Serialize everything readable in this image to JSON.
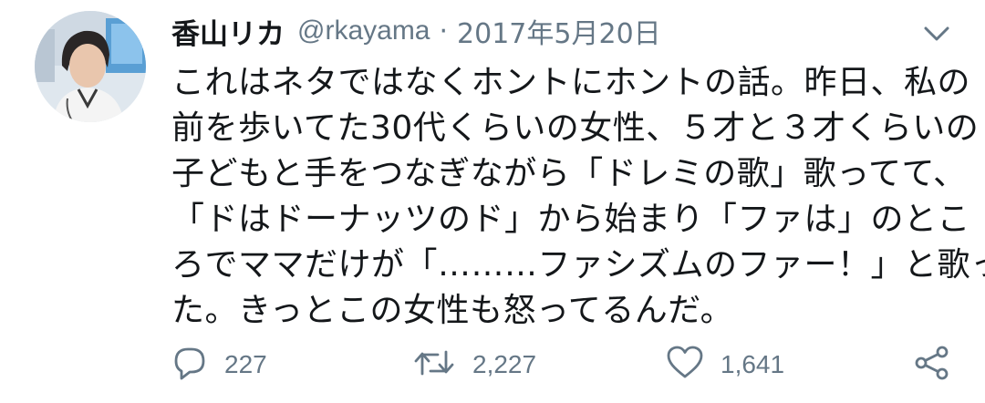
{
  "tweet": {
    "display_name": "香山リカ",
    "handle": "@rkayama",
    "separator": "·",
    "date": "2017年5月20日",
    "text_lines": [
      "これはネタではなくホントにホントの話。昨日、私の",
      "前を歩いてた30代くらいの女性、５才と３才くらいの",
      "子どもと手をつなぎながら「ドレミの歌」歌ってて、",
      "「ドはドーナッツのド」から始まり「ファは」のとこ",
      "ろでママだけが「………ファシズムのファー！」と歌っ",
      "た。きっとこの女性も怒ってるんだ。"
    ],
    "reply_count": "227",
    "retweet_count": "2,227",
    "like_count": "1,641"
  },
  "icons": {
    "avatar": "avatar",
    "caret": "chevron-down-icon",
    "reply": "reply-icon",
    "retweet": "retweet-icon",
    "like": "heart-icon",
    "share": "share-icon"
  },
  "colors": {
    "text": "#14171a",
    "muted": "#657786"
  }
}
